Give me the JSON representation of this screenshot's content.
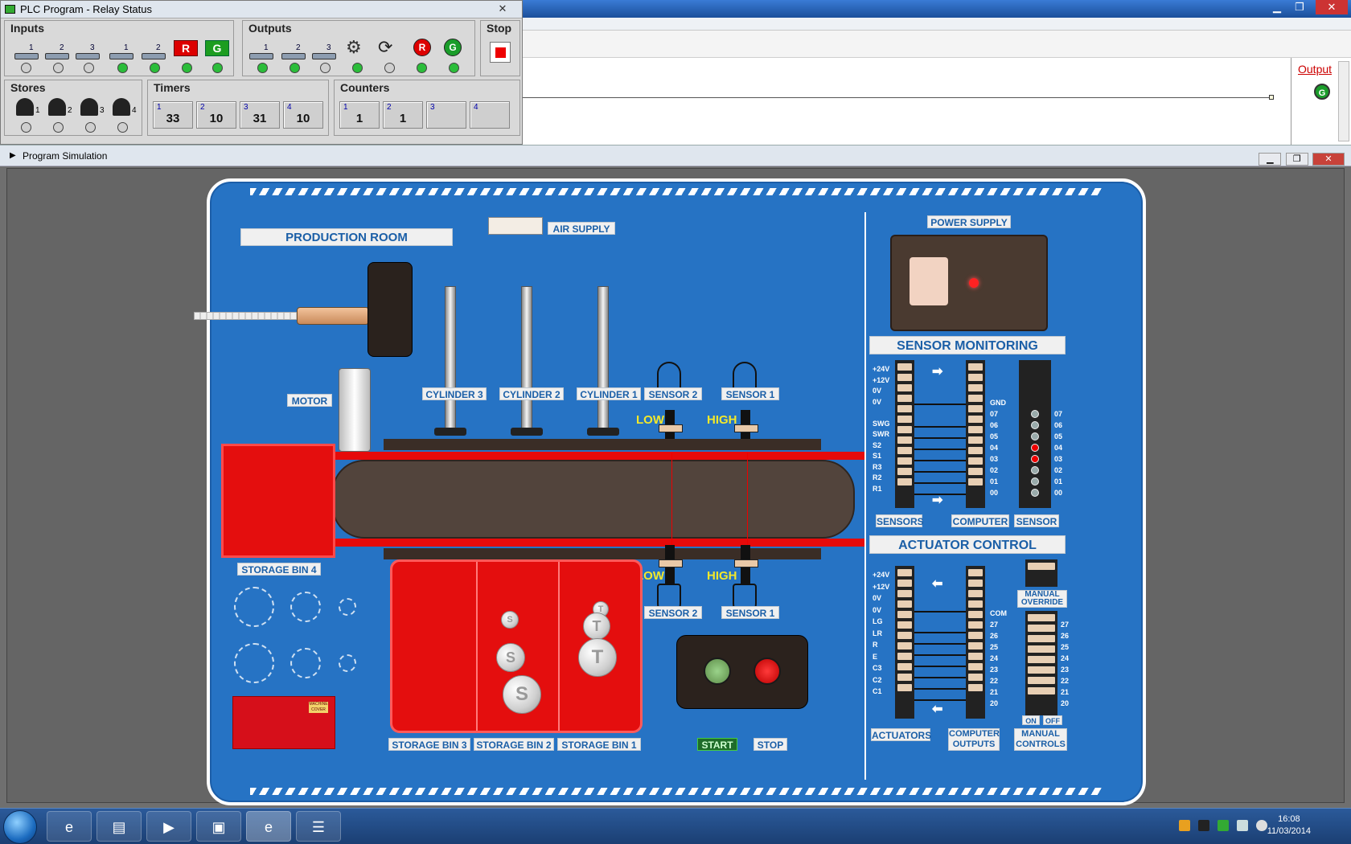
{
  "relay": {
    "title": "PLC Program - Relay Status",
    "close": "✕",
    "inputs_title": "Inputs",
    "outputs_title": "Outputs",
    "stop_title": "Stop",
    "stores_title": "Stores",
    "timers_title": "Timers",
    "counters_title": "Counters",
    "input_nums": [
      "1",
      "2",
      "3",
      "1",
      "2"
    ],
    "input_states": [
      false,
      false,
      false,
      true,
      true,
      true,
      true
    ],
    "output_nums": [
      "1",
      "2",
      "3"
    ],
    "output_states": [
      true,
      true,
      false,
      true,
      false,
      true,
      true
    ],
    "btn_r": "R",
    "btn_g": "G",
    "store_nums": [
      "1",
      "2",
      "3",
      "4"
    ],
    "timers": [
      {
        "n": "1",
        "v": "33"
      },
      {
        "n": "2",
        "v": "10"
      },
      {
        "n": "3",
        "v": "31"
      },
      {
        "n": "4",
        "v": "10"
      }
    ],
    "counters": [
      {
        "n": "1",
        "v": "1"
      },
      {
        "n": "2",
        "v": "1"
      },
      {
        "n": "3",
        "v": ""
      },
      {
        "n": "4",
        "v": ""
      }
    ]
  },
  "ladder": {
    "output_label": "Output",
    "output_lamp": "G"
  },
  "sim": {
    "title": "Program Simulation",
    "production_room": "PRODUCTION ROOM",
    "air_supply": "AIR SUPPLY",
    "power_supply": "POWER SUPPLY",
    "motor": "MOTOR",
    "cylinders": [
      "CYLINDER 3",
      "CYLINDER 2",
      "CYLINDER 1"
    ],
    "sensor2": "SENSOR 2",
    "sensor1": "SENSOR 1",
    "low": "LOW",
    "high": "HIGH",
    "storage_bin_4": "STORAGE BIN 4",
    "storage_bin_3": "STORAGE BIN 3",
    "storage_bin_2": "STORAGE BIN 2",
    "storage_bin_1": "STORAGE BIN 1",
    "start": "START",
    "stop": "STOP",
    "sensor_monitoring": "SENSOR MONITORING",
    "actuator_control": "ACTUATOR CONTROL",
    "sensors": "SENSORS",
    "computer": "COMPUTER",
    "sensor": "SENSOR",
    "actuators": "ACTUATORS",
    "computer_outputs": "COMPUTER OUTPUTS",
    "manual_override": "MANUAL OVERRIDE",
    "manual_controls": "MANUAL CONTROLS",
    "on": "ON",
    "off": "OFF",
    "sensor_left_labels": [
      "+24V",
      "+12V",
      "0V",
      "0V",
      "",
      "SWG",
      "SWR",
      "S2",
      "S1",
      "R3",
      "R2",
      "R1"
    ],
    "sensor_right_labels": [
      "GND",
      "07",
      "06",
      "05",
      "04",
      "03",
      "02",
      "01",
      "00"
    ],
    "sensor_led_labels": [
      "07",
      "06",
      "05",
      "04",
      "03",
      "02",
      "01",
      "00"
    ],
    "sensor_led_states": [
      false,
      false,
      false,
      true,
      true,
      false,
      false,
      false
    ],
    "act_left_labels": [
      "+24V",
      "+12V",
      "0V",
      "0V",
      "LG",
      "LR",
      "R",
      "E",
      "C3",
      "C2",
      "C1"
    ],
    "act_right_labels": [
      "COM",
      "27",
      "26",
      "25",
      "24",
      "23",
      "22",
      "21",
      "20"
    ],
    "manual_labels": [
      "27",
      "26",
      "25",
      "24",
      "23",
      "22",
      "21",
      "20"
    ],
    "badge": "MACHINE COVER",
    "ball_s": "S",
    "ball_t": "T"
  },
  "taskbar": {
    "time": "16:08",
    "date": "11/03/2014"
  }
}
